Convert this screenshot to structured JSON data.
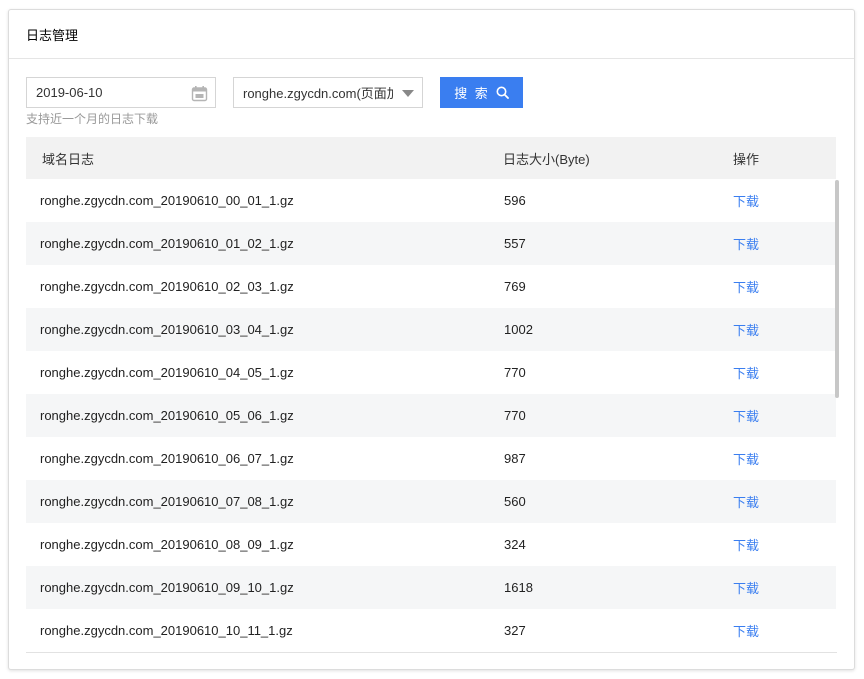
{
  "panel": {
    "title": "日志管理"
  },
  "filters": {
    "date_value": "2019-06-10",
    "domain_selected": "ronghe.zgycdn.com(页面加",
    "search_label": "搜 索",
    "hint": "支持近一个月的日志下载"
  },
  "table": {
    "headers": {
      "name": "域名日志",
      "size": "日志大小(Byte)",
      "action": "操作"
    },
    "rows": [
      {
        "name": "ronghe.zgycdn.com_20190610_00_01_1.gz",
        "size": "596",
        "action": "下载"
      },
      {
        "name": "ronghe.zgycdn.com_20190610_01_02_1.gz",
        "size": "557",
        "action": "下载"
      },
      {
        "name": "ronghe.zgycdn.com_20190610_02_03_1.gz",
        "size": "769",
        "action": "下载"
      },
      {
        "name": "ronghe.zgycdn.com_20190610_03_04_1.gz",
        "size": "1002",
        "action": "下载"
      },
      {
        "name": "ronghe.zgycdn.com_20190610_04_05_1.gz",
        "size": "770",
        "action": "下载"
      },
      {
        "name": "ronghe.zgycdn.com_20190610_05_06_1.gz",
        "size": "770",
        "action": "下载"
      },
      {
        "name": "ronghe.zgycdn.com_20190610_06_07_1.gz",
        "size": "987",
        "action": "下载"
      },
      {
        "name": "ronghe.zgycdn.com_20190610_07_08_1.gz",
        "size": "560",
        "action": "下载"
      },
      {
        "name": "ronghe.zgycdn.com_20190610_08_09_1.gz",
        "size": "324",
        "action": "下载"
      },
      {
        "name": "ronghe.zgycdn.com_20190610_09_10_1.gz",
        "size": "1618",
        "action": "下载"
      },
      {
        "name": "ronghe.zgycdn.com_20190610_10_11_1.gz",
        "size": "327",
        "action": "下载"
      }
    ]
  },
  "colors": {
    "accent": "#3a7ef0",
    "header_bg": "#f2f2f2",
    "stripe": "#f5f6f7"
  },
  "icons": {
    "date": "calendar-icon",
    "search": "search-icon",
    "dropdown": "caret-down-icon"
  }
}
